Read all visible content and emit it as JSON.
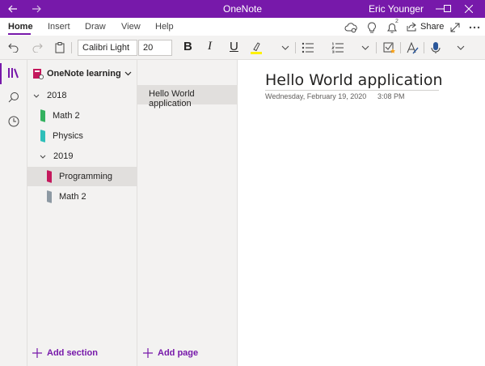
{
  "titlebar": {
    "app_title": "OneNote",
    "user_name": "Eric Younger"
  },
  "ribbon": {
    "tabs": [
      {
        "label": "Home",
        "active": true
      },
      {
        "label": "Insert",
        "active": false
      },
      {
        "label": "Draw",
        "active": false
      },
      {
        "label": "View",
        "active": false
      },
      {
        "label": "Help",
        "active": false
      }
    ],
    "notification_count": "2",
    "share_label": "Share"
  },
  "toolbar": {
    "font_name": "Calibri Light",
    "font_size": "20",
    "bold_label": "B",
    "italic_label": "I",
    "underline_label": "U",
    "highlight_color": "#fff100"
  },
  "notebook": {
    "name": "OneNote learning",
    "groups": [
      {
        "name": "2018",
        "sections": [
          {
            "name": "Math 2",
            "color": "#33b15f",
            "selected": false
          },
          {
            "name": "Physics",
            "color": "#2ebfb9",
            "selected": false
          }
        ]
      },
      {
        "name": "2019",
        "sections": [
          {
            "name": "Programming",
            "color": "#c4185c",
            "selected": true
          },
          {
            "name": "Math 2",
            "color": "#8d99a3",
            "selected": false
          }
        ]
      }
    ],
    "add_section_label": "Add section"
  },
  "pages": {
    "items": [
      {
        "title": "Hello World application",
        "selected": true
      }
    ],
    "add_page_label": "Add page"
  },
  "canvas": {
    "page_title": "Hello World application",
    "date": "Wednesday, February 19, 2020",
    "time": "3:08 PM"
  },
  "colors": {
    "brand": "#7719aa",
    "pane_bg": "#f3f2f1",
    "selected_bg": "#e1dfdd"
  }
}
